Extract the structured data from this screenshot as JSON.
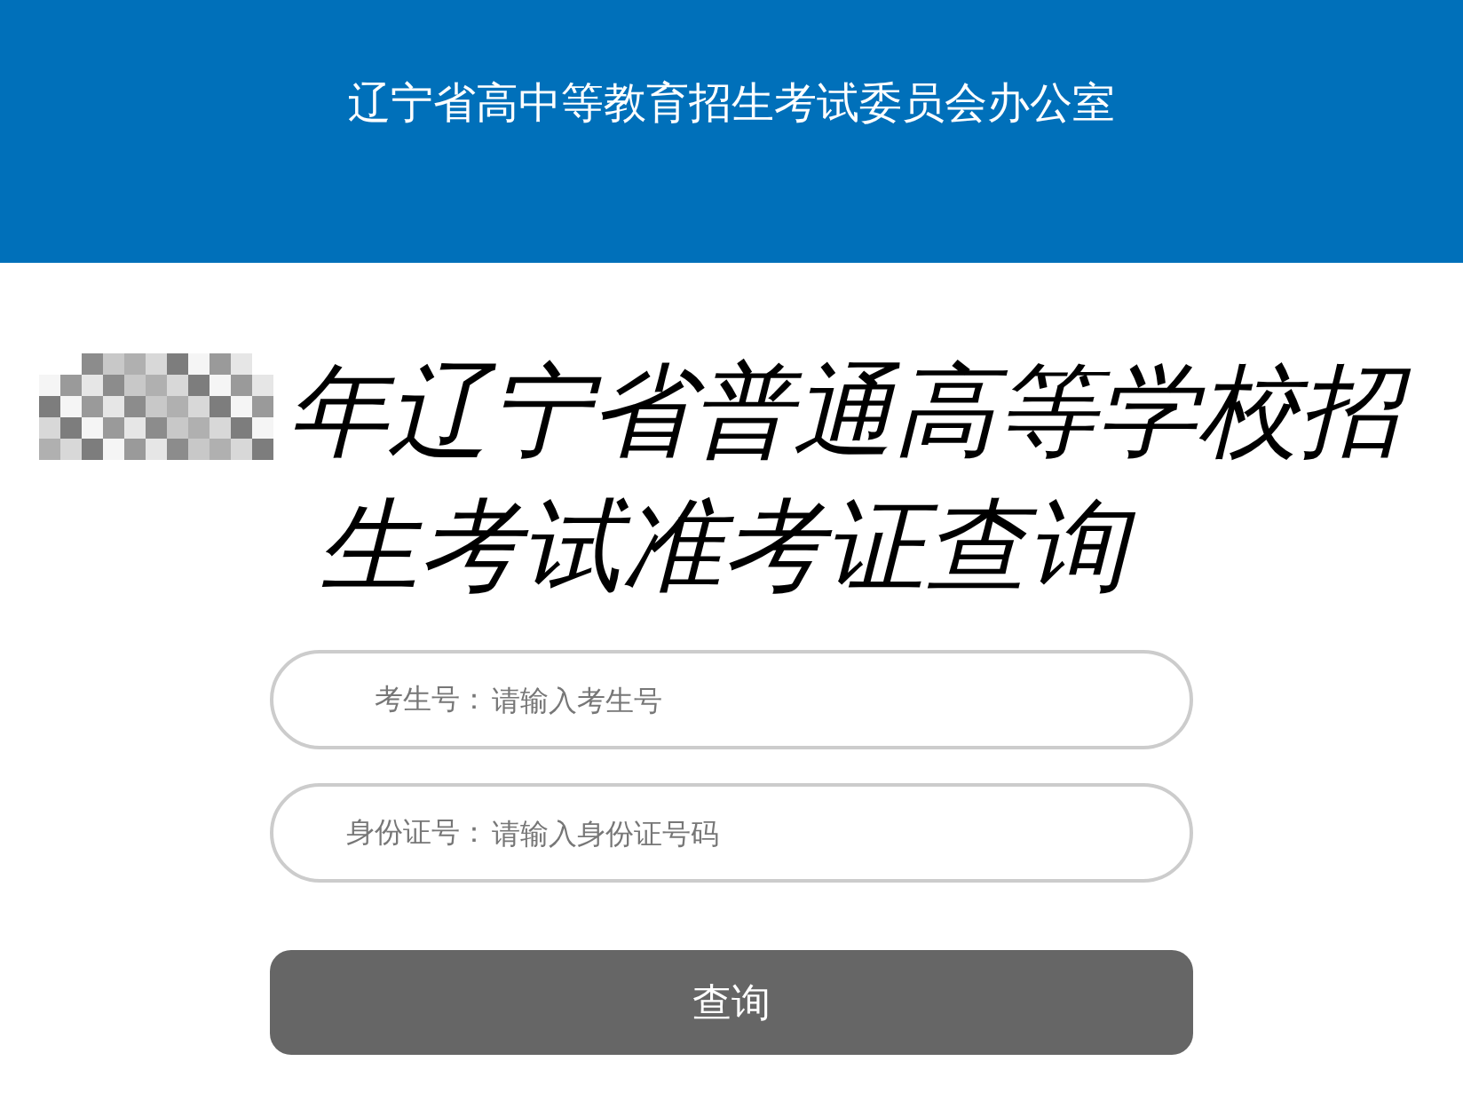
{
  "header": {
    "title": "辽宁省高中等教育招生考试委员会办公室"
  },
  "page_title": {
    "redacted": true,
    "text": "年辽宁省普通高等学校招生考试准考证查询"
  },
  "fields": [
    {
      "label": "考生号：",
      "placeholder": "请输入考生号"
    },
    {
      "label": "身份证号：",
      "placeholder": "请输入身份证号码"
    }
  ],
  "submit_button": "查询"
}
